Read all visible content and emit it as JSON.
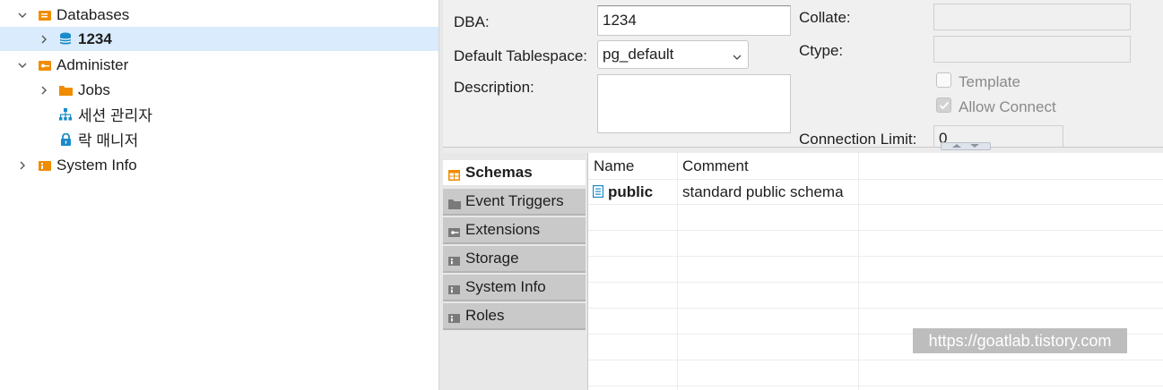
{
  "tree": {
    "databases": "Databases",
    "db_1234": "1234",
    "administer": "Administer",
    "jobs": "Jobs",
    "session_manager": "세션 관리자",
    "lock_manager": "락 매니저",
    "system_info": "System Info"
  },
  "properties": {
    "dba_label": "DBA:",
    "dba_value": "1234",
    "tablespace_label": "Default Tablespace:",
    "tablespace_value": "pg_default",
    "description_label": "Description:",
    "description_value": "",
    "collate_label": "Collate:",
    "collate_value": "",
    "ctype_label": "Ctype:",
    "ctype_value": "",
    "template_label": "Template",
    "template_checked": false,
    "allow_connect_label": "Allow Connect",
    "allow_connect_checked": true,
    "connection_limit_label": "Connection Limit:",
    "connection_limit_value": "0"
  },
  "tabs": [
    "Schemas",
    "Event Triggers",
    "Extensions",
    "Storage",
    "System Info",
    "Roles"
  ],
  "schemas_table": {
    "columns": [
      "Name",
      "Comment"
    ],
    "rows": [
      {
        "name": "public",
        "comment": "standard public schema"
      }
    ]
  },
  "watermark": "https://goatlab.tistory.com",
  "colors": {
    "selected_row": "#d9ebfc",
    "folder_orange": "#f08c00",
    "db_blue": "#1a8bc9"
  }
}
